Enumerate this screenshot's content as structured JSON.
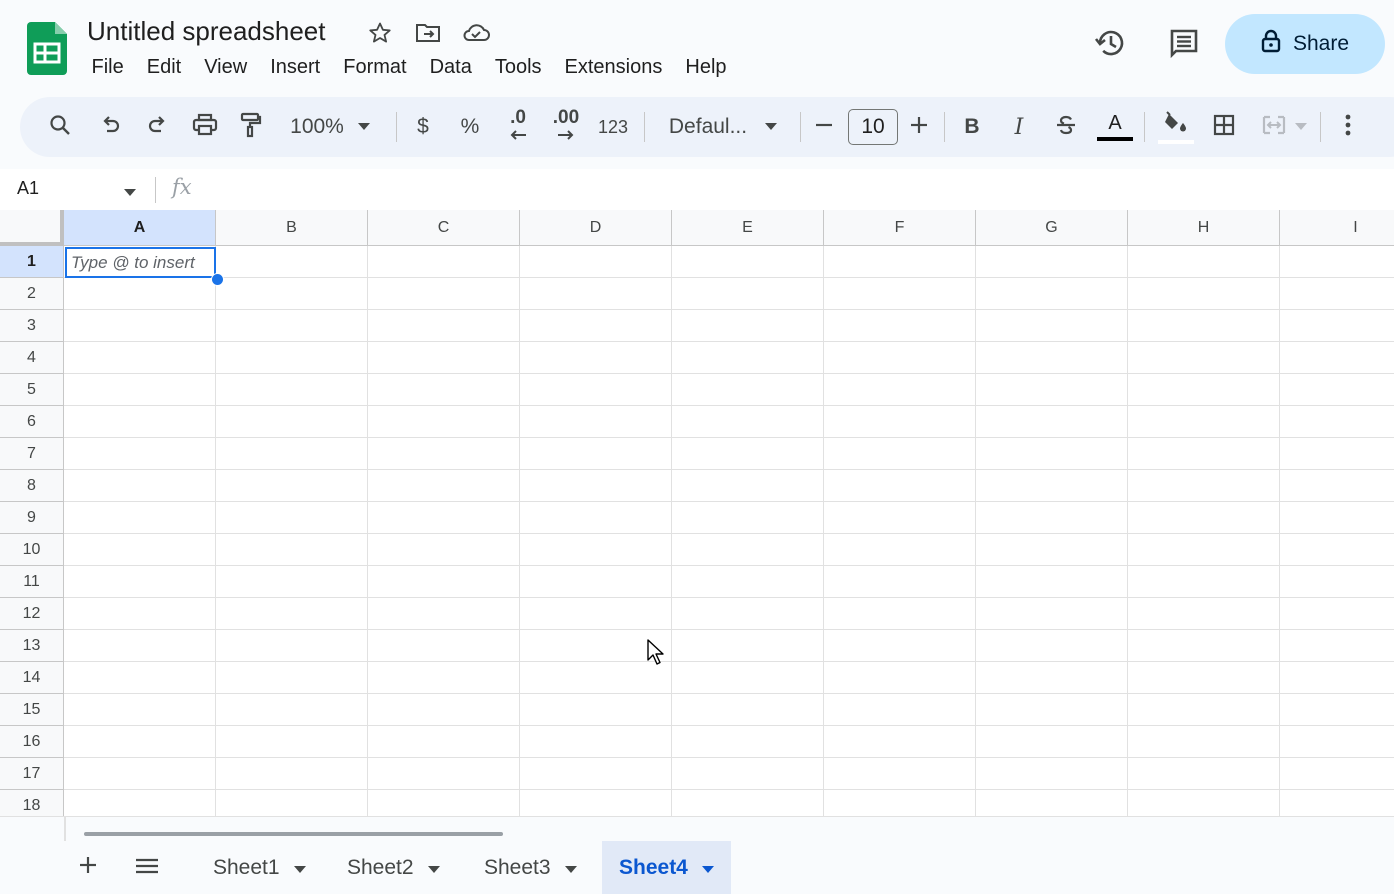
{
  "header": {
    "title": "Untitled spreadsheet",
    "menu": [
      "File",
      "Edit",
      "View",
      "Insert",
      "Format",
      "Data",
      "Tools",
      "Extensions",
      "Help"
    ],
    "share_label": "Share"
  },
  "toolbar": {
    "zoom": "100%",
    "currency": "$",
    "percent": "%",
    "decrease_decimal": ".0",
    "increase_decimal": ".00",
    "number_format": "123",
    "font": "Defaul...",
    "font_size": "10",
    "bold": "B",
    "italic": "I",
    "text_color_letter": "A"
  },
  "formula_bar": {
    "name_box": "A1",
    "fx": "fx"
  },
  "grid": {
    "columns": [
      "A",
      "B",
      "C",
      "D",
      "E",
      "F",
      "G",
      "H",
      "I"
    ],
    "rows": [
      "1",
      "2",
      "3",
      "4",
      "5",
      "6",
      "7",
      "8",
      "9",
      "10",
      "11",
      "12",
      "13",
      "14",
      "15",
      "16",
      "17",
      "18"
    ],
    "selected_cell": "A1",
    "cell_a1_placeholder": "Type @ to insert"
  },
  "tabs": {
    "sheets": [
      "Sheet1",
      "Sheet2",
      "Sheet3",
      "Sheet4"
    ],
    "active": "Sheet4"
  },
  "colors": {
    "accent": "#0b57d0",
    "selection": "#1a73e8",
    "share_bg": "#c2e7ff",
    "logo_green": "#0f9d58"
  }
}
